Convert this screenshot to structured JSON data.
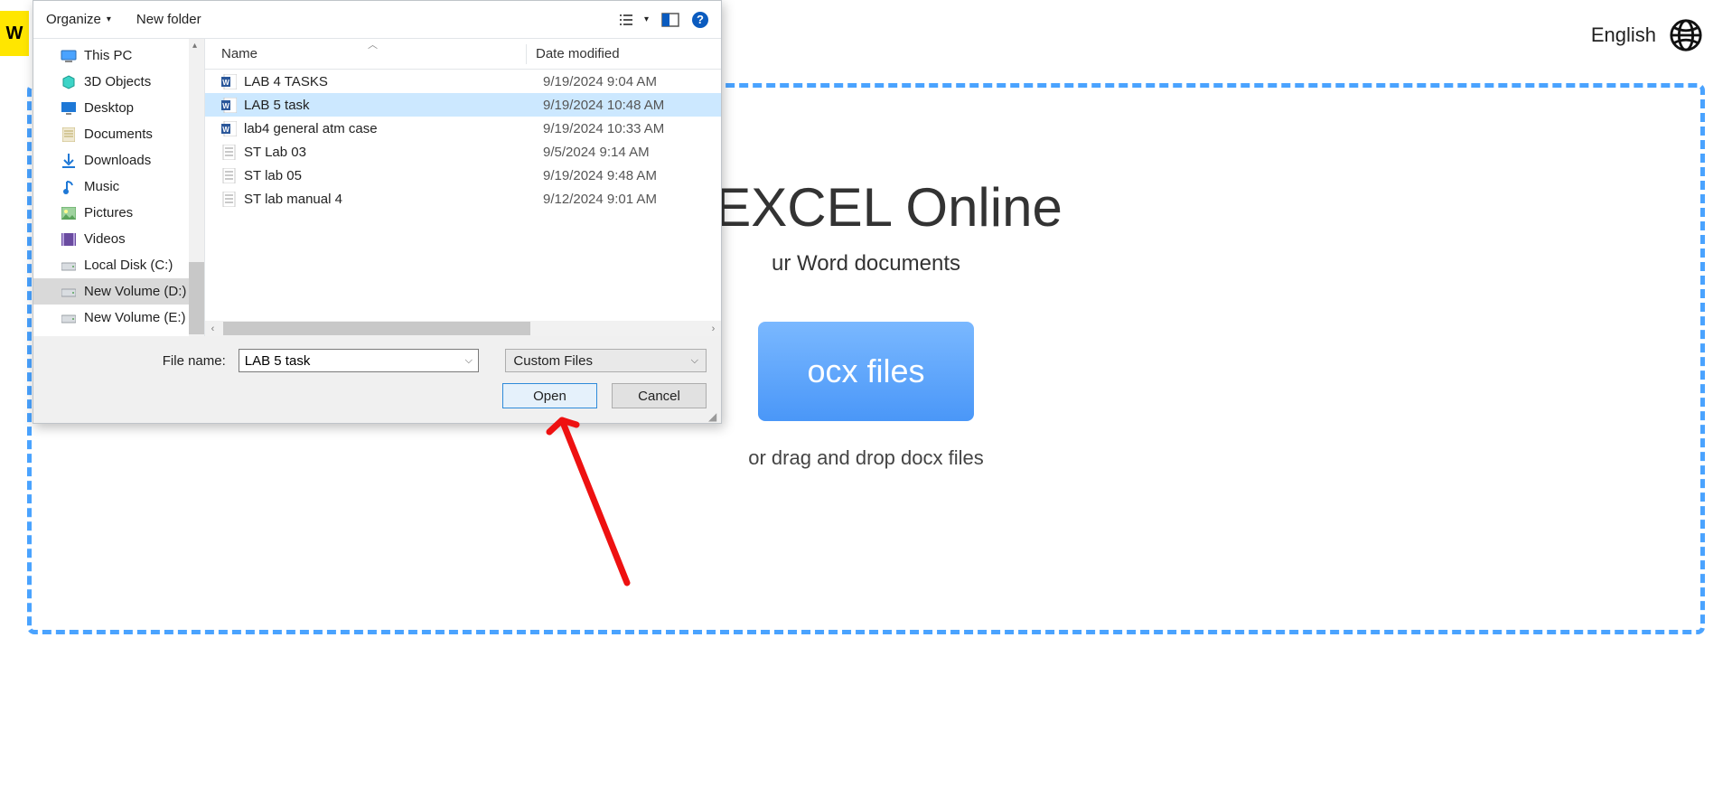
{
  "topbar": {
    "language_label": "English",
    "yellow_letter": "W"
  },
  "dropzone": {
    "title_suffix": "o EXCEL Online",
    "sub_suffix": "ur Word documents",
    "button_suffix": "ocx files",
    "hint": "or drag and drop docx files"
  },
  "dialog": {
    "toolbar": {
      "organize": "Organize",
      "new_folder": "New folder"
    },
    "nav": [
      {
        "label": "This PC",
        "icon": "pc"
      },
      {
        "label": "3D Objects",
        "icon": "3d"
      },
      {
        "label": "Desktop",
        "icon": "desktop"
      },
      {
        "label": "Documents",
        "icon": "doc"
      },
      {
        "label": "Downloads",
        "icon": "down"
      },
      {
        "label": "Music",
        "icon": "music"
      },
      {
        "label": "Pictures",
        "icon": "pic"
      },
      {
        "label": "Videos",
        "icon": "video"
      },
      {
        "label": "Local Disk (C:)",
        "icon": "disk"
      },
      {
        "label": "New Volume (D:)",
        "icon": "disk",
        "selected": true
      },
      {
        "label": "New Volume (E:)",
        "icon": "disk"
      }
    ],
    "columns": {
      "name": "Name",
      "date": "Date modified"
    },
    "files": [
      {
        "name": "LAB 4 TASKS",
        "date": "9/19/2024 9:04 AM",
        "icon": "word"
      },
      {
        "name": "LAB 5 task",
        "date": "9/19/2024 10:48 AM",
        "icon": "word",
        "selected": true
      },
      {
        "name": "lab4 general atm case",
        "date": "9/19/2024 10:33 AM",
        "icon": "word"
      },
      {
        "name": "ST Lab 03",
        "date": "9/5/2024 9:14 AM",
        "icon": "generic"
      },
      {
        "name": "ST lab 05",
        "date": "9/19/2024 9:48 AM",
        "icon": "generic"
      },
      {
        "name": "ST lab manual 4",
        "date": "9/12/2024 9:01 AM",
        "icon": "generic"
      }
    ],
    "footer": {
      "filename_label": "File name:",
      "filename_value": "LAB 5 task",
      "filter": "Custom Files",
      "open": "Open",
      "cancel": "Cancel"
    }
  }
}
